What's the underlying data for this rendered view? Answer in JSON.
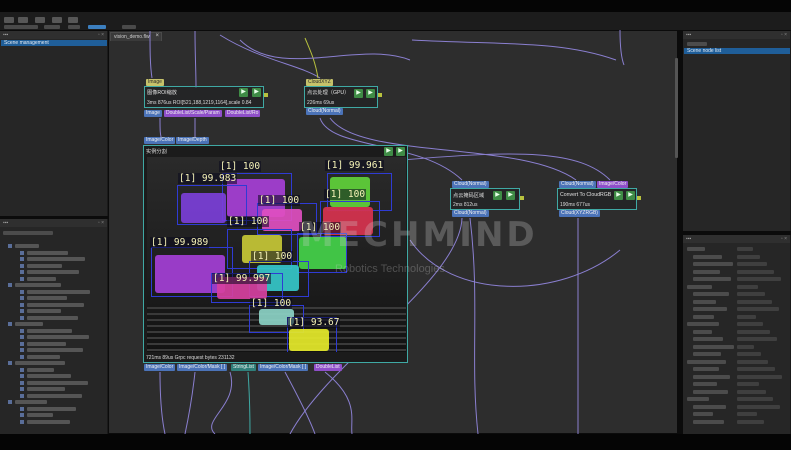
{
  "canvas": {
    "tab_label": "vision_demo.flw",
    "tab_close": "×"
  },
  "left_panel": {
    "selected_item": "Scene management"
  },
  "right_panel": {
    "selected_item": "Scene node list"
  },
  "watermark": {
    "brand": "MECHMIND",
    "tagline": "Robotics Technologies"
  },
  "nodes": {
    "roi_scale": {
      "input_port": "Image",
      "title": "图像ROI缩放",
      "stats": "3ms 876us ROI[521,188,1219,1164],scale 0.84",
      "ports": [
        "Image",
        "DoubleList/Scale/Param",
        "DoubleList/Ro"
      ]
    },
    "pointcloud_process": {
      "input_port": "CloudXYZ",
      "title": "点云处理（GPU）",
      "stats": "226ms 69us",
      "ports": [
        "Cloud(Normal)"
      ]
    },
    "segmentation": {
      "input_ports": [
        "Image/Color",
        "Image/Depth"
      ],
      "title": "实例分割",
      "stats": "721ms 89us Grpc request bytes 231132",
      "ports": [
        "Image/Color",
        "Image/Color/Mask [ ]",
        "StringList",
        "Image/Color/Mask [ ]",
        "DoubleList"
      ]
    },
    "mask_filter": {
      "input_port": "Cloud(Normal)",
      "title": "点云掩码区域",
      "stats": "2ms 812us",
      "ports": [
        "Cloud(Normal)"
      ]
    },
    "convert_rgb": {
      "input_ports": [
        "Cloud(Normal)",
        "Image/Color"
      ],
      "title": "Convert To CloudRGB",
      "stats": "190ms 677us",
      "ports": [
        "Cloud(XYZRGB)"
      ]
    }
  },
  "detections": [
    {
      "label": "[1] 100",
      "color": "#a63fd6"
    },
    {
      "label": "[1] 99.983",
      "color": "#7b3fd8"
    },
    {
      "label": "[1] 99.961",
      "color": "#5fd13a"
    },
    {
      "label": "[1] 100",
      "color": "#d8334f"
    },
    {
      "label": "[1] 100",
      "color": "#e04fc0"
    },
    {
      "label": "[1] 100",
      "color": "#c7c836"
    },
    {
      "label": "[1] 100",
      "color": "#44d34a"
    },
    {
      "label": "[1] 99.989",
      "color": "#a43fd6"
    },
    {
      "label": "[1] 100",
      "color": "#35c7c9"
    },
    {
      "label": "[1] 99.997",
      "color": "#d6409f"
    },
    {
      "label": "[1] 100",
      "color": "#8cd3c6"
    },
    {
      "label": "[1] 93.67",
      "color": "#e6ea2a"
    }
  ],
  "colors": {
    "node_border": "#3fa9a4",
    "selection": "#1f5e99",
    "box_outline": "#2f3bd4"
  }
}
